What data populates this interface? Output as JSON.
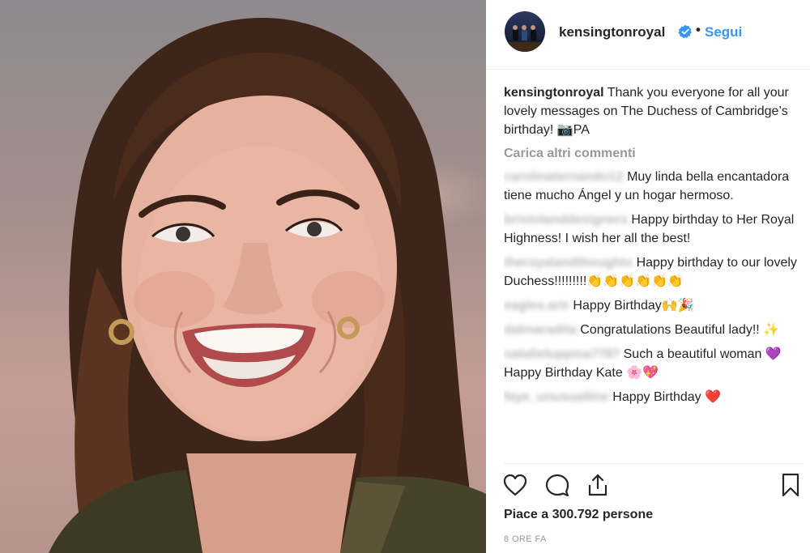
{
  "post": {
    "author": "kensingtonroyal",
    "verified_icon": "verified-badge-icon",
    "separator": "•",
    "follow_label": "Segui",
    "photo_description": "",
    "caption": {
      "username": "kensingtonroyal",
      "text": "Thank you everyone for all your lovely messages on The Duchess of Cambridge’s birthday! 📷PA"
    },
    "load_more_label": "Carica altri commenti",
    "comments": [
      {
        "username": "carolinaternando12",
        "text": "Muy linda bella encantadora tiene mucho Ángel y un hogar hermoso."
      },
      {
        "username": "bristolanddesigners",
        "text": "Happy birthday to Her Royal Highness! I wish her all the best!"
      },
      {
        "username": "theroyalandthoughts",
        "text": "Happy birthday to our lovely Duchess!!!!!!!!!👏👏👏👏👏👏"
      },
      {
        "username": "eagles.artr",
        "text": "Happy Birthday🙌🎉"
      },
      {
        "username": "dalmaradita",
        "text": "Congratulations Beautiful lady!! ✨"
      },
      {
        "username": "natalieluppina7787",
        "text": "Such a beautiful woman 💜 Happy Birthday Kate 🌸💖"
      },
      {
        "username": "faye_unusualline",
        "text": "Happy Birthday ❤️"
      }
    ],
    "actions": {
      "like_icon": "heart-icon",
      "comment_icon": "comment-icon",
      "share_icon": "share-icon",
      "save_icon": "bookmark-icon"
    },
    "likes_label": "Piace a 300.792 persone",
    "timestamp": "8 ORE FA",
    "colors": {
      "link": "#3897f0",
      "verified": "#3897f0",
      "text": "#262626",
      "muted": "#999999"
    }
  }
}
